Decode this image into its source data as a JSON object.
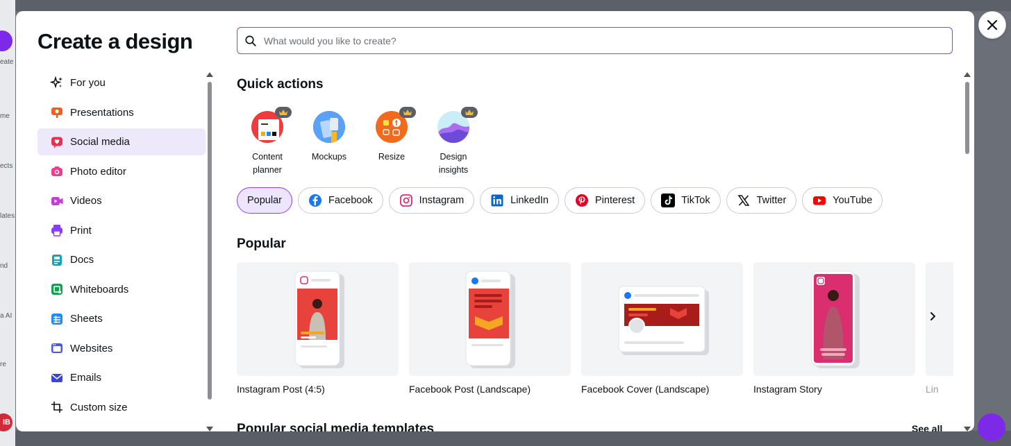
{
  "background": {
    "avatar_initials": "IB",
    "left_labels": [
      "eate",
      "me",
      "ects",
      "lates",
      "nd",
      "a AI",
      "re"
    ]
  },
  "modal": {
    "title": "Create a design",
    "search": {
      "placeholder": "What would you like to create?",
      "value": ""
    }
  },
  "sidebar": {
    "items": [
      {
        "label": "For you",
        "icon": "sparkle-icon",
        "color": "#0d1216"
      },
      {
        "label": "Presentations",
        "icon": "presentation-icon",
        "color": "#f05f1e"
      },
      {
        "label": "Social media",
        "icon": "heart-chat-icon",
        "color": "#ec2d53",
        "active": true
      },
      {
        "label": "Photo editor",
        "icon": "camera-icon",
        "color": "#ee3d8e"
      },
      {
        "label": "Videos",
        "icon": "video-icon",
        "color": "#c43dd8"
      },
      {
        "label": "Print",
        "icon": "printer-icon",
        "color": "#8b3dff"
      },
      {
        "label": "Docs",
        "icon": "docs-icon",
        "color": "#13a3b5"
      },
      {
        "label": "Whiteboards",
        "icon": "whiteboard-icon",
        "color": "#0ea44f"
      },
      {
        "label": "Sheets",
        "icon": "sheets-icon",
        "color": "#1d8cf2"
      },
      {
        "label": "Websites",
        "icon": "websites-icon",
        "color": "#4a57e5"
      },
      {
        "label": "Emails",
        "icon": "email-icon",
        "color": "#3b44d6"
      },
      {
        "label": "Custom size",
        "icon": "custom-size-icon",
        "color": "#0d1216"
      }
    ]
  },
  "quick_actions": {
    "title": "Quick actions",
    "items": [
      {
        "label": "Content planner",
        "icon": "calendar-planner-icon",
        "premium": true
      },
      {
        "label": "Mockups",
        "icon": "mockups-icon",
        "premium": false
      },
      {
        "label": "Resize",
        "icon": "resize-icon",
        "premium": true
      },
      {
        "label": "Design insights",
        "icon": "insights-chart-icon",
        "premium": true
      }
    ]
  },
  "chips": [
    {
      "label": "Popular",
      "active": true
    },
    {
      "label": "Facebook",
      "icon": "facebook-icon"
    },
    {
      "label": "Instagram",
      "icon": "instagram-icon"
    },
    {
      "label": "LinkedIn",
      "icon": "linkedin-icon"
    },
    {
      "label": "Pinterest",
      "icon": "pinterest-icon"
    },
    {
      "label": "TikTok",
      "icon": "tiktok-icon"
    },
    {
      "label": "Twitter",
      "icon": "x-icon"
    },
    {
      "label": "YouTube",
      "icon": "youtube-icon"
    }
  ],
  "popular": {
    "title": "Popular",
    "cards": [
      {
        "label": "Instagram Post (4:5)"
      },
      {
        "label": "Facebook Post (Landscape)"
      },
      {
        "label": "Facebook Cover (Landscape)"
      },
      {
        "label": "Instagram Story"
      },
      {
        "label": "Lin"
      }
    ]
  },
  "templates_section": {
    "title": "Popular social media templates",
    "see_all": "See all"
  },
  "colors": {
    "accent": "#8b3dff",
    "active_bg": "#eee8fb",
    "template_red": "#e8423d",
    "template_orange": "#f5a623",
    "story_pink": "#d92f6f"
  }
}
